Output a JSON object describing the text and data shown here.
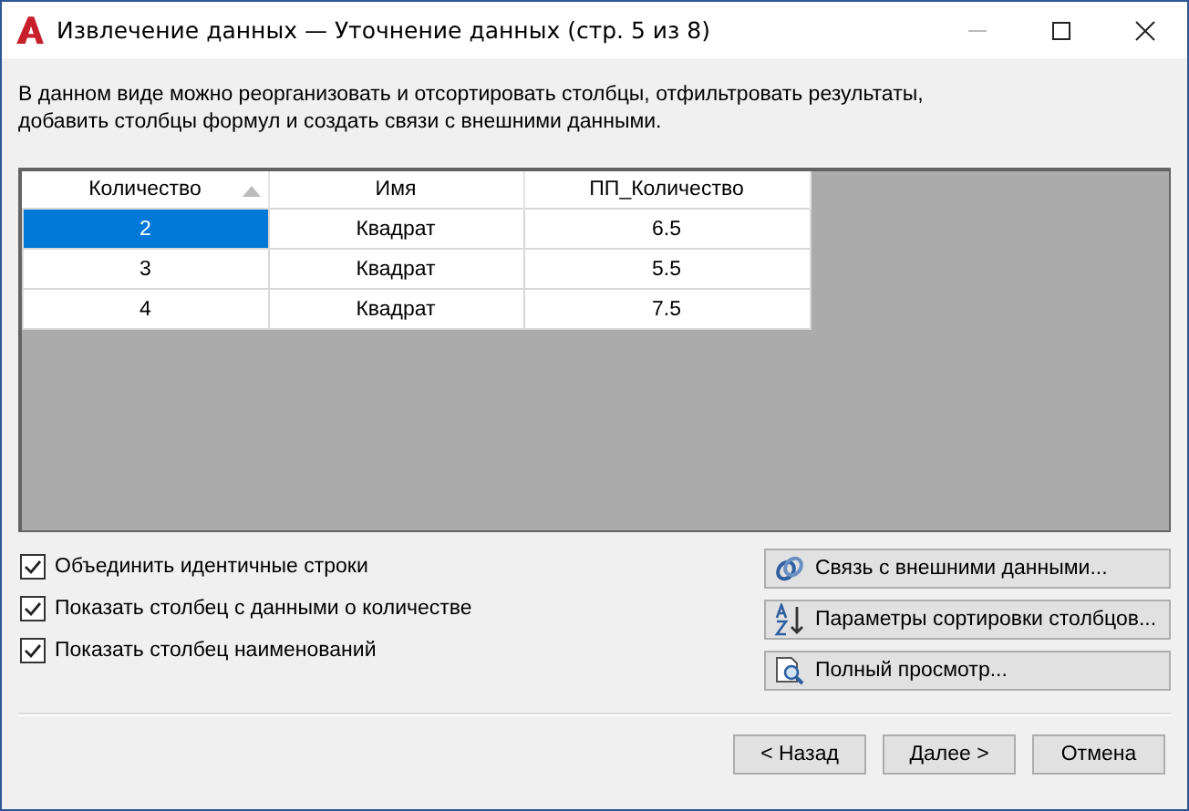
{
  "window": {
    "title": "Извлечение данных — Уточнение данных (стр. 5 из 8)"
  },
  "description": "В данном виде можно реорганизовать и отсортировать столбцы, отфильтровать результаты, добавить столбцы формул и создать связи с внешними данными.",
  "table": {
    "columns": [
      {
        "label": "Количество",
        "sorted": true
      },
      {
        "label": "Имя",
        "sorted": false
      },
      {
        "label": "ПП_Количество",
        "sorted": false
      }
    ],
    "rows": [
      {
        "cells": [
          "2",
          "Квадрат",
          "6.5"
        ],
        "selected": true
      },
      {
        "cells": [
          "3",
          "Квадрат",
          "5.5"
        ],
        "selected": false
      },
      {
        "cells": [
          "4",
          "Квадрат",
          "7.5"
        ],
        "selected": false
      }
    ]
  },
  "options": [
    {
      "label": "Объединить идентичные строки",
      "checked": true
    },
    {
      "label": "Показать столбец с данными о количестве",
      "checked": true
    },
    {
      "label": "Показать столбец наименований",
      "checked": true
    }
  ],
  "actions": [
    {
      "label": "Связь с внешними данными...",
      "kind": "link"
    },
    {
      "label": "Параметры сортировки столбцов...",
      "kind": "sort"
    },
    {
      "label": "Полный просмотр...",
      "kind": "preview"
    }
  ],
  "buttons": [
    "< Назад",
    "Далее >",
    "Отмена"
  ]
}
